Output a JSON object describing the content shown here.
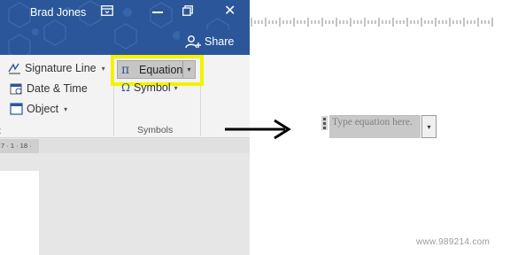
{
  "titlebar": {
    "user_name": "Brad Jones",
    "share_label": "Share"
  },
  "ribbon": {
    "signature_line_label": "Signature Line",
    "date_time_label": "Date & Time",
    "object_label": "Object",
    "left_group_label": "t",
    "equation_label": "Equation",
    "symbol_label": "Symbol",
    "symbols_group_label": "Symbols",
    "dropdown_glyph": "▾"
  },
  "ruler": {
    "left_text": "7 · 1 · 18 ·"
  },
  "equation_field": {
    "placeholder": "Type equation here."
  },
  "watermark": "www.989214.com",
  "colors": {
    "title_bar": "#2b579a",
    "highlight": "#f3f300",
    "ribbon_bg": "#f3f3f3"
  }
}
